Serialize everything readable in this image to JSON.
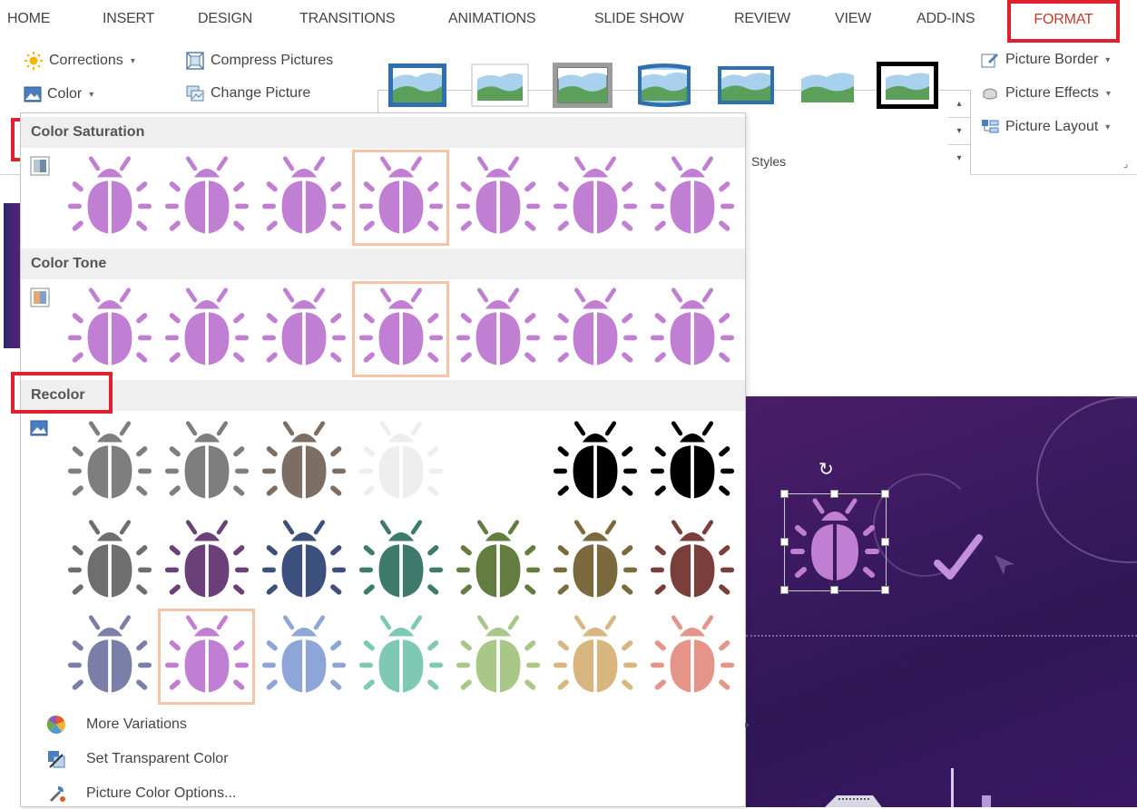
{
  "tabs": [
    "HOME",
    "INSERT",
    "DESIGN",
    "TRANSITIONS",
    "ANIMATIONS",
    "SLIDE SHOW",
    "REVIEW",
    "VIEW",
    "ADD-INS",
    "FORMAT"
  ],
  "ribbon": {
    "corrections": "Corrections",
    "color": "Color",
    "compress_pictures": "Compress Pictures",
    "change_picture": "Change Picture",
    "picture_border": "Picture Border",
    "picture_effects": "Picture Effects",
    "picture_layout": "Picture Layout",
    "styles_label": "Styles"
  },
  "dropdown": {
    "color_saturation": "Color Saturation",
    "color_tone": "Color Tone",
    "recolor": "Recolor",
    "saturation_swatches": [
      {
        "name": "saturation-0",
        "body": "#c17fd3",
        "selected": false
      },
      {
        "name": "saturation-33",
        "body": "#c17fd3",
        "selected": false
      },
      {
        "name": "saturation-66",
        "body": "#c17fd3",
        "selected": false
      },
      {
        "name": "saturation-100",
        "body": "#c17fd3",
        "selected": true
      },
      {
        "name": "saturation-200",
        "body": "#c17fd3",
        "selected": false
      },
      {
        "name": "saturation-300",
        "body": "#c17fd3",
        "selected": false
      },
      {
        "name": "saturation-400",
        "body": "#c17fd3",
        "selected": false
      }
    ],
    "tone_swatches": [
      {
        "name": "temperature-4700",
        "body": "#c17fd3",
        "selected": false
      },
      {
        "name": "temperature-5300",
        "body": "#c17fd3",
        "selected": false
      },
      {
        "name": "temperature-5900",
        "body": "#c17fd3",
        "selected": false
      },
      {
        "name": "temperature-6500",
        "body": "#c17fd3",
        "selected": true
      },
      {
        "name": "temperature-7200",
        "body": "#c17fd3",
        "selected": false
      },
      {
        "name": "temperature-7800",
        "body": "#c17fd3",
        "selected": false
      },
      {
        "name": "temperature-8800",
        "body": "#c17fd3",
        "selected": false
      }
    ],
    "recolor_rows": [
      [
        {
          "name": "grayscale",
          "body": "#7e7e7e",
          "selected": false
        },
        {
          "name": "grayscale-light",
          "body": "#7e7e7e",
          "selected": false
        },
        {
          "name": "sepia",
          "body": "#7c6e63",
          "selected": false
        },
        {
          "name": "washout",
          "body": "#eeeeee",
          "selected": false
        },
        {
          "name": "empty",
          "body": null,
          "selected": false
        },
        {
          "name": "black-and-white-25",
          "body": "#000000",
          "selected": false
        },
        {
          "name": "black-and-white-50",
          "body": "#000000",
          "selected": false
        }
      ],
      [
        {
          "name": "dark-gray",
          "body": "#6e6e6e",
          "selected": false
        },
        {
          "name": "dark-purple",
          "body": "#6b3f78",
          "selected": false
        },
        {
          "name": "dark-blue",
          "body": "#3d4f7c",
          "selected": false
        },
        {
          "name": "dark-teal",
          "body": "#3e7a6b",
          "selected": false
        },
        {
          "name": "dark-green",
          "body": "#627d3f",
          "selected": false
        },
        {
          "name": "dark-olive",
          "body": "#7a6a3e",
          "selected": false
        },
        {
          "name": "dark-red",
          "body": "#7a3f3b",
          "selected": false
        }
      ],
      [
        {
          "name": "light-blue-gray",
          "body": "#7b7fa8",
          "selected": false
        },
        {
          "name": "light-purple",
          "body": "#c17fd3",
          "selected": true
        },
        {
          "name": "light-blue",
          "body": "#8ea6d7",
          "selected": false
        },
        {
          "name": "light-teal",
          "body": "#7fc8b4",
          "selected": false
        },
        {
          "name": "light-green",
          "body": "#a9c786",
          "selected": false
        },
        {
          "name": "light-tan",
          "body": "#d9b57f",
          "selected": false
        },
        {
          "name": "light-salmon",
          "body": "#e49488",
          "selected": false
        }
      ]
    ],
    "menu": {
      "more_variations": "More Variations",
      "set_transparent_color": "Set Transparent Color",
      "picture_color_options": "Picture Color Options..."
    }
  },
  "slide": {
    "icon_color": "#c17fd3",
    "check_color": "#c38fde"
  }
}
